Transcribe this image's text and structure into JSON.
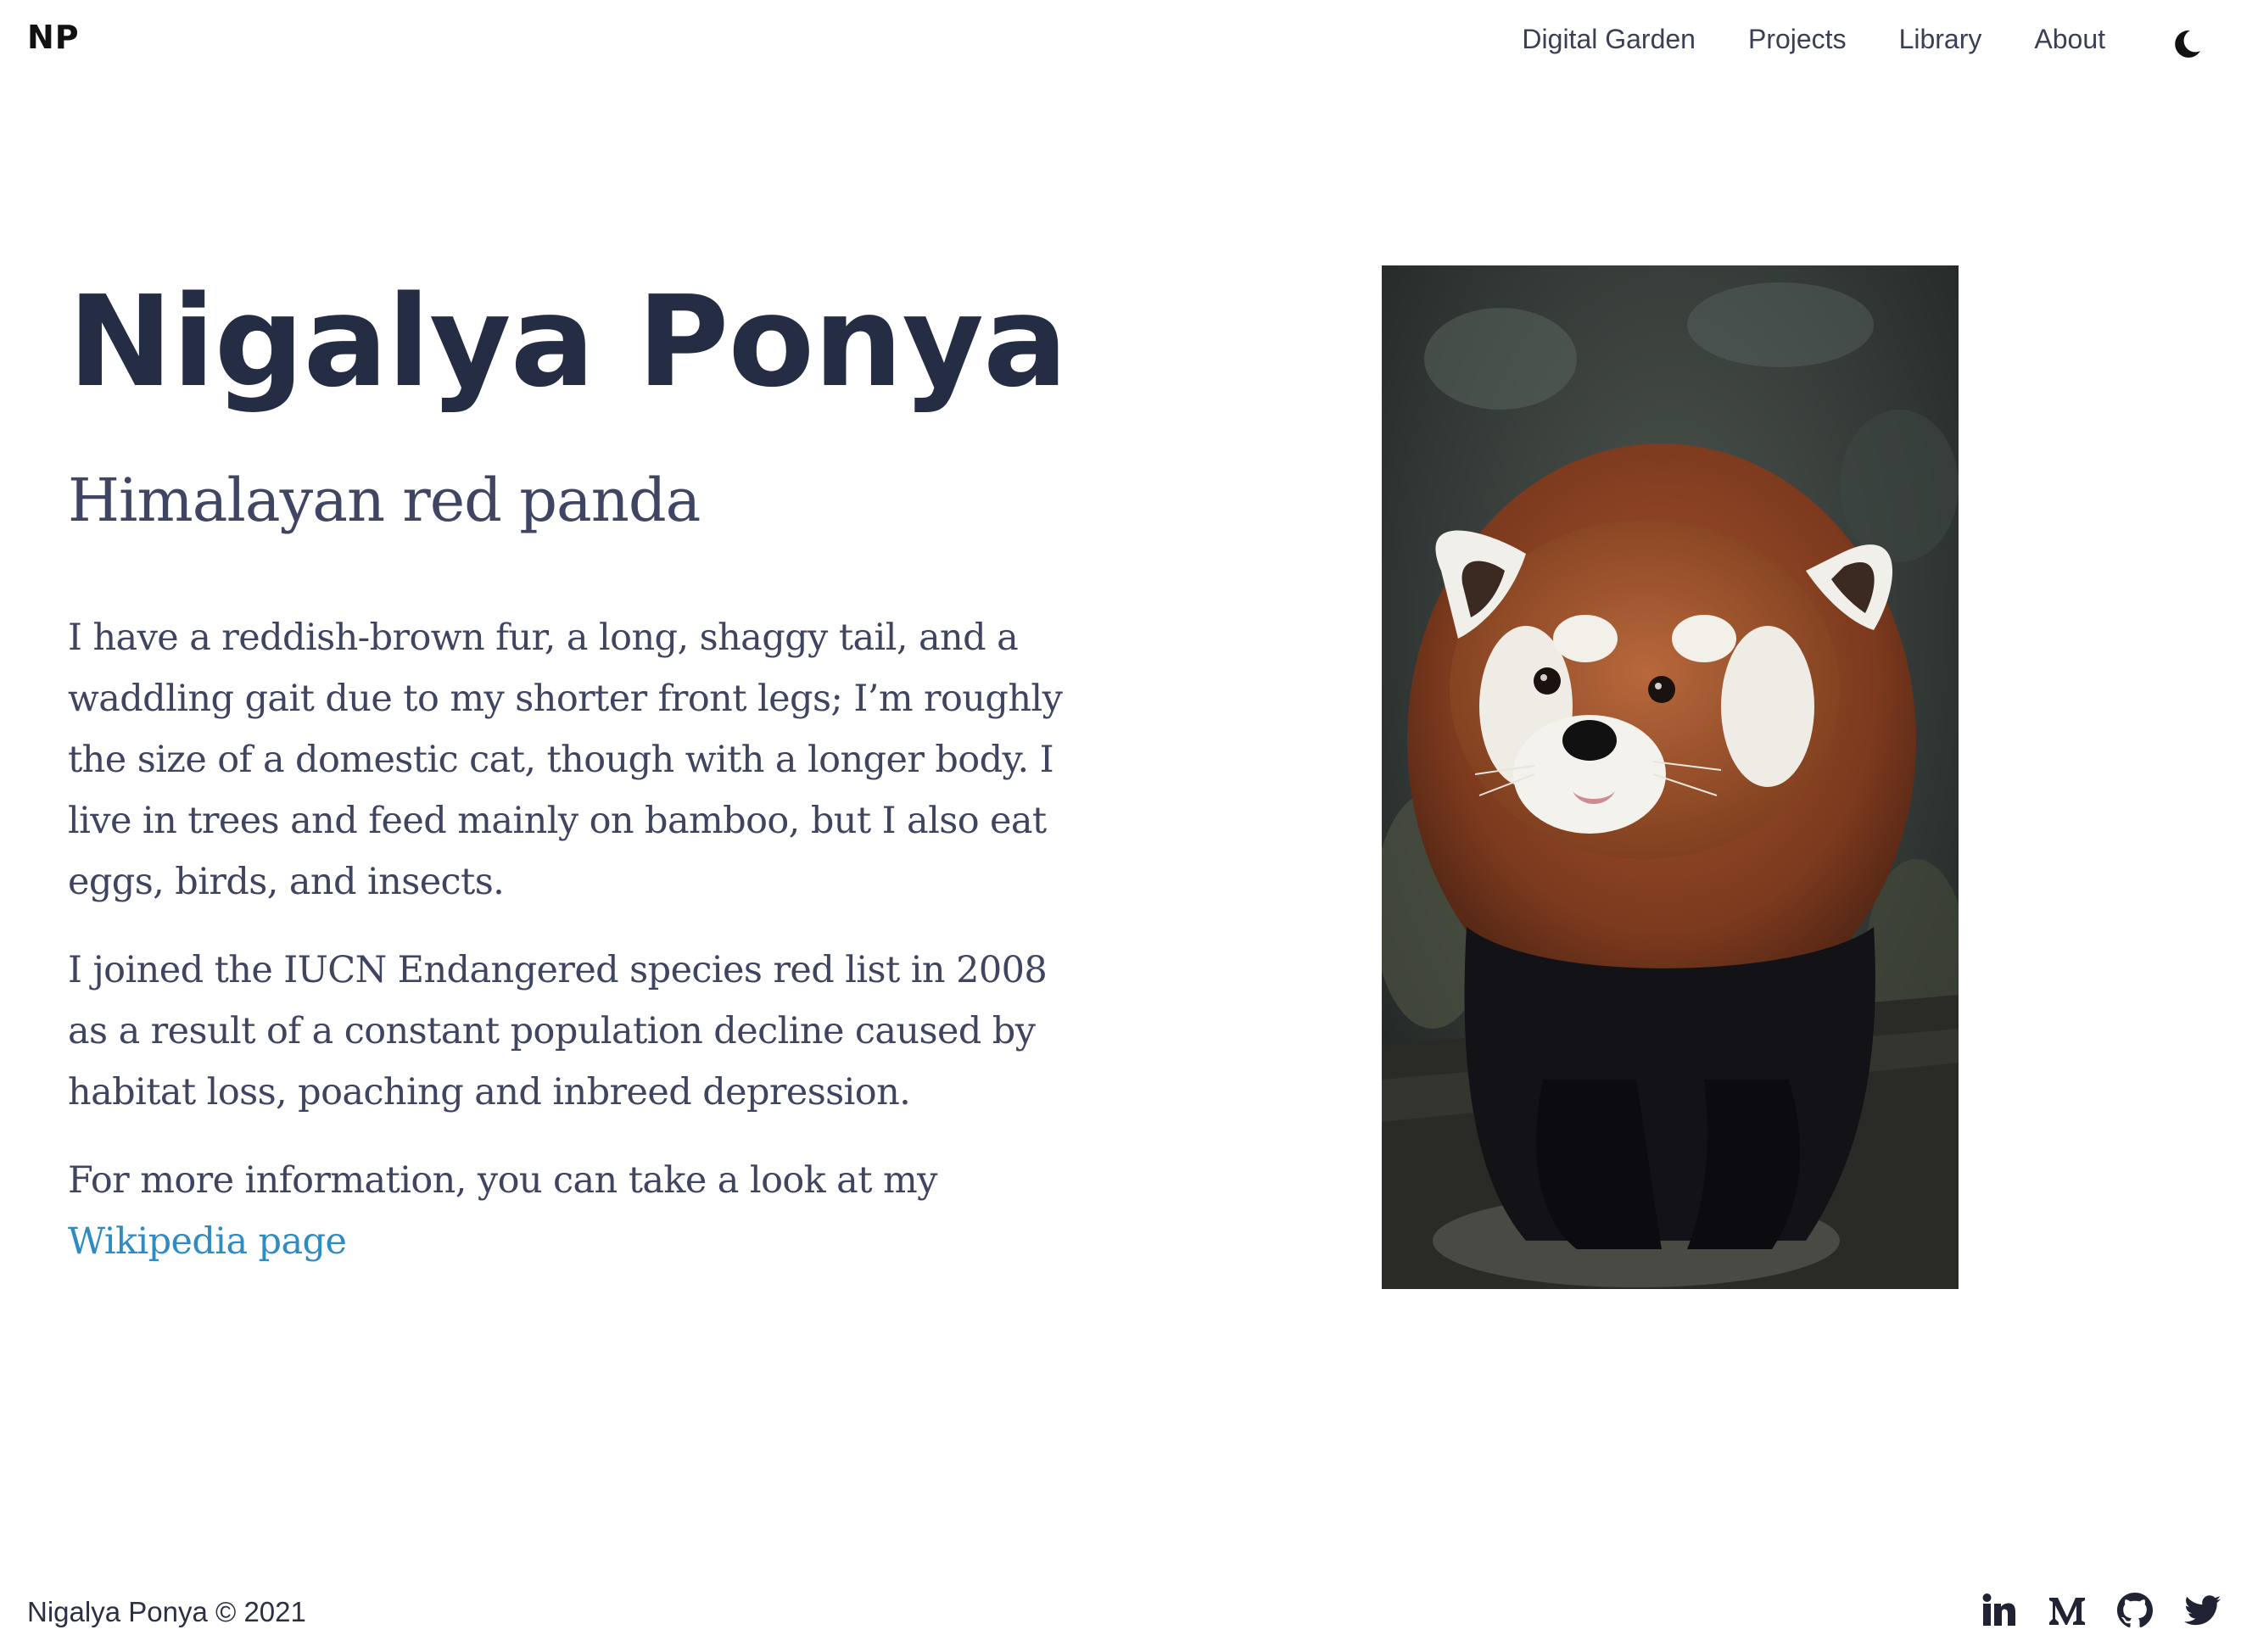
{
  "site": {
    "logo": "NP"
  },
  "nav": {
    "items": [
      {
        "label": "Digital Garden"
      },
      {
        "label": "Projects"
      },
      {
        "label": "Library"
      },
      {
        "label": "About"
      }
    ],
    "theme_toggle_icon": "moon-icon"
  },
  "hero": {
    "title": "Nigalya Ponya",
    "subtitle": "Himalayan red panda",
    "paragraphs": [
      "I have a reddish-brown fur, a long, shaggy tail, and a waddling gait due to my shorter front legs; I’m roughly the size of a domestic cat, though with a longer body. I live in trees and feed mainly on bamboo, but I also eat eggs, birds, and insects.",
      "I joined the IUCN Endangered species red list in 2008 as a result of a constant population decline caused by habitat loss, poaching and inbreed depression."
    ],
    "more_info_text": "For more information, you can take a look at my ",
    "link_text": "Wikipedia page",
    "link_color": "#2e8bc4"
  },
  "photo": {
    "subject": "red panda on a log"
  },
  "footer": {
    "copyright": "Nigalya Ponya © 2021",
    "socials": [
      {
        "icon": "linkedin-icon"
      },
      {
        "icon": "medium-icon"
      },
      {
        "icon": "github-icon"
      },
      {
        "icon": "twitter-icon"
      }
    ]
  },
  "colors": {
    "title": "#252d45",
    "body_text": "#3f4460",
    "link": "#2e8bc4",
    "background": "#ffffff"
  }
}
